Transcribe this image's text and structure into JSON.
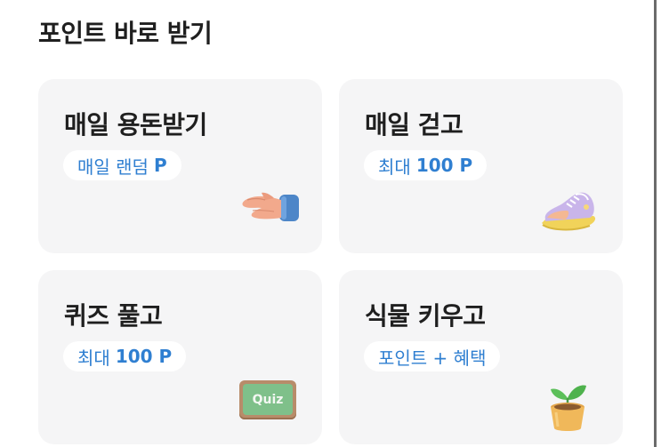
{
  "section": {
    "title": "포인트 바로 받기"
  },
  "cards": [
    {
      "title": "매일 용돈받기",
      "pill_text": "매일 랜덤",
      "pill_strong": "P",
      "icon": "hand-icon"
    },
    {
      "title": "매일 걷고",
      "pill_text": "최대",
      "pill_strong": "100 P",
      "icon": "sneaker-icon"
    },
    {
      "title": "퀴즈 풀고",
      "pill_text": "최대",
      "pill_strong": "100 P",
      "icon": "quiz-board-icon",
      "icon_text": "Quiz"
    },
    {
      "title": "식물 키우고",
      "pill_text": "포인트 + 혜택",
      "pill_strong": "",
      "icon": "plant-pot-icon"
    }
  ],
  "colors": {
    "card_bg": "#f5f5f6",
    "accent_blue": "#2f7fd1",
    "title_text": "#1f1f1f"
  }
}
